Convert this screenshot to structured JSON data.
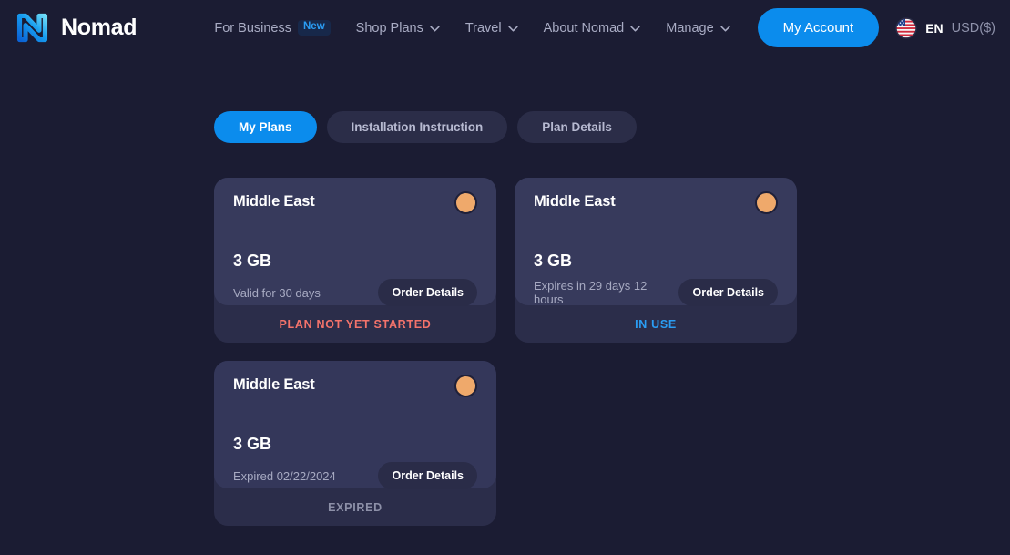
{
  "navbar": {
    "brand": "Nomad",
    "logo_icon": "nomad-logo-icon",
    "links": [
      {
        "label": "For Business",
        "badge": "New",
        "has_caret": false
      },
      {
        "label": "Shop Plans",
        "has_caret": true
      },
      {
        "label": "Travel",
        "has_caret": true
      },
      {
        "label": "About Nomad",
        "has_caret": true
      },
      {
        "label": "Manage",
        "has_caret": true
      }
    ],
    "account_button": "My Account",
    "flag_icon": "us-flag-icon",
    "language": "EN",
    "currency": "USD($)",
    "accent_color": "#0b8ced"
  },
  "tabs": [
    {
      "label": "My Plans",
      "active": true
    },
    {
      "label": "Installation Instruction",
      "active": false
    },
    {
      "label": "Plan Details",
      "active": false
    }
  ],
  "plans": [
    {
      "region": "Middle East",
      "data": "3 GB",
      "validity": "Valid for 30 days",
      "order_button": "Order Details",
      "status": "PLAN NOT YET STARTED",
      "status_color": "#f4736b",
      "flag_dot_color": "#efa96b"
    },
    {
      "region": "Middle East",
      "data": "3 GB",
      "validity": "Expires in 29 days 12 hours",
      "order_button": "Order Details",
      "status": "IN USE",
      "status_color": "#2a9df4",
      "flag_dot_color": "#efa96b"
    },
    {
      "region": "Middle East",
      "data": "3 GB",
      "validity": "Expired 02/22/2024",
      "order_button": "Order Details",
      "status": "EXPIRED",
      "status_color": "#8d90a8",
      "flag_dot_color": "#efa96b"
    }
  ]
}
